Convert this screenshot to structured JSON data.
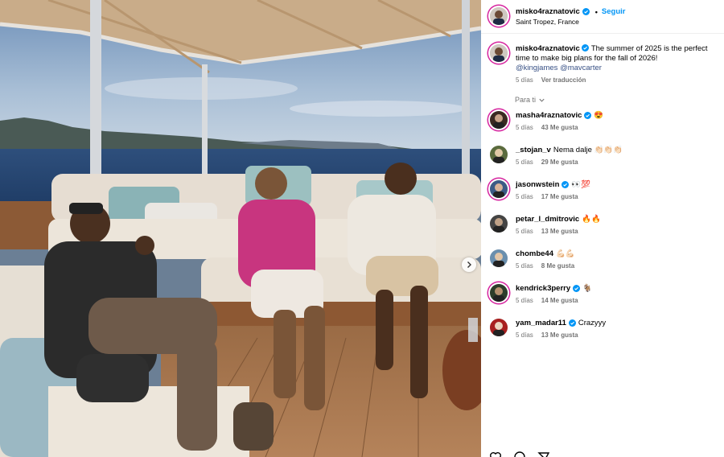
{
  "post": {
    "author": "misko4raznatovic",
    "follow_label": "Seguir",
    "location": "Saint Tropez, France",
    "caption_text": "The summer of 2025 is the perfect time to make big plans for the fall of 2026!",
    "mention_1": "@kingjames",
    "mention_2": "@mavcarter",
    "time_ago": "5 días",
    "translate_label": "Ver traducción",
    "sort_label": "Para ti"
  },
  "comments": [
    {
      "user": "masha4raznatovic",
      "verified": true,
      "text": "😍",
      "time": "5 días",
      "likes": "43 Me gusta"
    },
    {
      "user": "_stojan_v",
      "verified": false,
      "text": "Nema dalje 👏🏻👏🏻👏🏻",
      "time": "5 días",
      "likes": "29 Me gusta"
    },
    {
      "user": "jasonwstein",
      "verified": true,
      "text": "👀💯",
      "time": "5 días",
      "likes": "17 Me gusta"
    },
    {
      "user": "petar_l_dmitrovic",
      "verified": false,
      "text": "🔥🔥",
      "time": "5 días",
      "likes": "13 Me gusta"
    },
    {
      "user": "chombe44",
      "verified": false,
      "text": "💪🏻💪🏻",
      "time": "5 días",
      "likes": "8 Me gusta"
    },
    {
      "user": "kendrick3perry",
      "verified": true,
      "text": "🐐",
      "time": "5 días",
      "likes": "14 Me gusta"
    },
    {
      "user": "yam_madar11",
      "verified": true,
      "text": "Crazyyy",
      "time": "5 días",
      "likes": "13 Me gusta"
    }
  ],
  "icons": {
    "verified": "verified-badge-icon",
    "next": "chevron-right-icon",
    "sort": "chevron-down-icon",
    "like": "heart-icon",
    "comment": "comment-icon",
    "share": "paper-plane-icon"
  },
  "colors": {
    "accent": "#0095f6",
    "mention": "#385185",
    "secondary_text": "#737373",
    "story_ring": "#d6249f"
  }
}
